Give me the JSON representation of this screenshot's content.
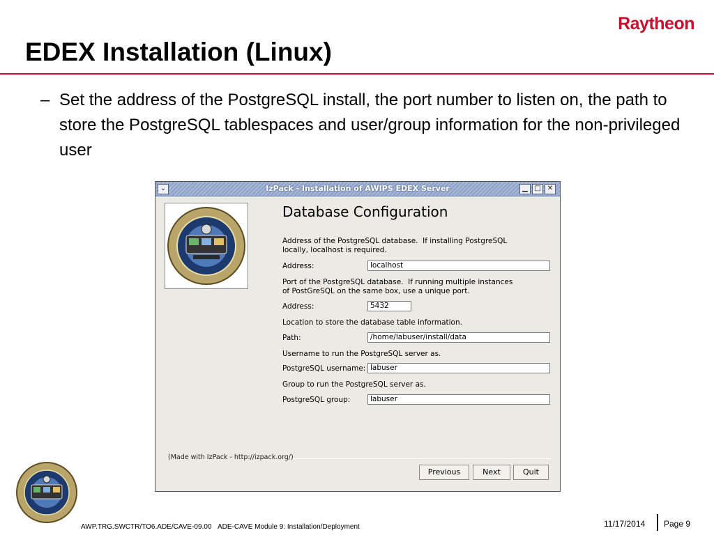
{
  "slide": {
    "brand": "Raytheon",
    "title": "EDEX Installation (Linux)",
    "bullet_dash": "–",
    "bullet_text": "Set the address of the PostgreSQL install, the port number to listen on, the path to store the PostgreSQL tablespaces and user/group information for the non-privileged user"
  },
  "window": {
    "title": "IzPack - Installation of AWIPS EDEX Server",
    "menu_glyph": "⌄",
    "minimize_glyph": "▁",
    "maximize_glyph": "□",
    "close_glyph": "✕",
    "heading": "Database Configuration",
    "address_desc": "Address of the PostgreSQL database.  If installing PostgreSQL\nlocally, localhost is required.",
    "address_label": "Address:",
    "address_value": "localhost",
    "port_desc": "Port of the PostgreSQL database.  If running multiple instances\nof PostGreSQL on the same box, use a unique port.",
    "port_label": "Address:",
    "port_value": "5432",
    "path_desc": "Location to store the database table information.",
    "path_label": "Path:",
    "path_value": "/home/labuser/install/data",
    "user_desc": "Username to run the PostgreSQL server as.",
    "user_label": "PostgreSQL username:",
    "user_value": "labuser",
    "group_desc": "Group to run the PostgreSQL server as.",
    "group_label": "PostgreSQL group:",
    "group_value": "labuser",
    "credit": "(Made with IzPack - http://izpack.org/)",
    "previous_label": "Previous",
    "next_label": "Next",
    "quit_label": "Quit"
  },
  "footer": {
    "doc_id": "AWP.TRG.SWCTR/TO6.ADE/CAVE-09.00",
    "module": "ADE-CAVE Module 9: Installation/Deployment",
    "date": "11/17/2014",
    "page": "Page 9"
  },
  "colors": {
    "brand_red": "#c8102e",
    "titlebar_blue": "#8ea2c8",
    "dialog_bg": "#eceae4"
  }
}
